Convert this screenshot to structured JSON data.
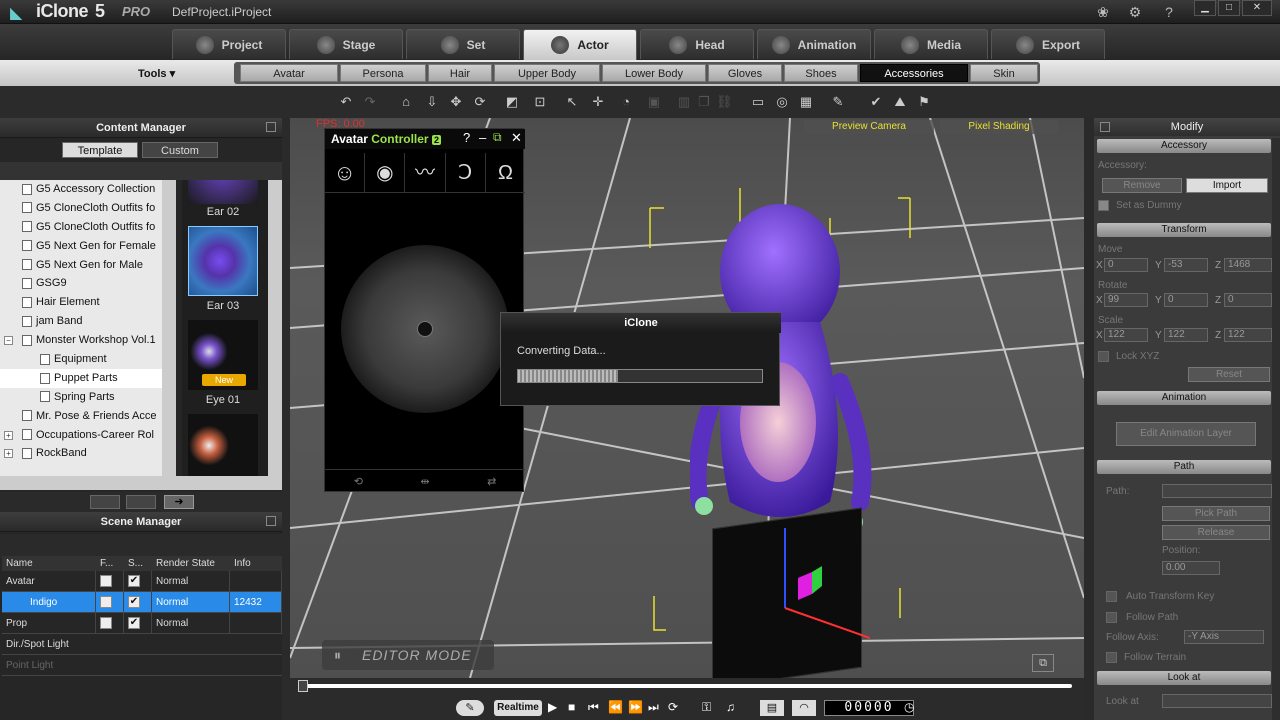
{
  "titlebar": {
    "app": "iClone",
    "version": "5",
    "edition": "PRO",
    "project": "DefProject.iProject"
  },
  "main_tabs": [
    {
      "label": "Project"
    },
    {
      "label": "Stage"
    },
    {
      "label": "Set"
    },
    {
      "label": "Actor",
      "active": true
    },
    {
      "label": "Head"
    },
    {
      "label": "Animation"
    },
    {
      "label": "Media"
    },
    {
      "label": "Export"
    }
  ],
  "tools_label": "Tools ▾",
  "sub_tabs": [
    {
      "label": "Avatar"
    },
    {
      "label": "Persona"
    },
    {
      "label": "Hair"
    },
    {
      "label": "Upper Body"
    },
    {
      "label": "Lower Body"
    },
    {
      "label": "Gloves"
    },
    {
      "label": "Shoes"
    },
    {
      "label": "Accessories",
      "active": true
    },
    {
      "label": "Skin"
    }
  ],
  "content_manager": {
    "title": "Content Manager",
    "tabs": [
      "Template",
      "Custom"
    ],
    "tree": [
      "G5 Accessory Collection",
      "G5 CloneCloth Outfits fo",
      "G5 CloneCloth Outfits fo",
      "G5 Next Gen for Female",
      "G5 Next Gen for Male",
      "GSG9",
      "Hair Element",
      "jam Band",
      "Monster Workshop Vol.1",
      "Equipment",
      "Puppet Parts",
      "Spring Parts",
      "Mr. Pose & Friends Acce",
      "Occupations-Career Rol",
      "RockBand"
    ],
    "thumbnails": [
      {
        "label": "Ear 02"
      },
      {
        "label": "Ear 03"
      },
      {
        "label": "Eye 01",
        "badge": "New"
      },
      {
        "label": ""
      }
    ]
  },
  "scene_manager": {
    "title": "Scene Manager",
    "columns": [
      "Name",
      "F...",
      "S...",
      "Render State",
      "Info"
    ],
    "rows": [
      {
        "name": "Avatar",
        "render": "Normal",
        "info": ""
      },
      {
        "name": "Indigo",
        "render": "Normal",
        "info": "12432",
        "selected": true
      },
      {
        "name": "Prop",
        "render": "Normal",
        "info": ""
      },
      {
        "name": "Dir./Spot Light",
        "render": "",
        "info": ""
      },
      {
        "name": "Point Light",
        "render": "",
        "info": ""
      }
    ]
  },
  "viewport": {
    "fps": "FPS: 0.00",
    "camera": "Preview Camera",
    "shading": "Pixel Shading",
    "editor_mode": "EDITOR MODE"
  },
  "avatar_controller": {
    "title": "Avatar",
    "title_b": "Controller",
    "version": "2"
  },
  "dialog": {
    "title": "iClone",
    "message": "Converting Data...",
    "progress_fraction": 0.41
  },
  "timeline": {
    "realtime": "Realtime",
    "frame": "00000"
  },
  "modify": {
    "title": "Modify",
    "accessory_header": "Accessory",
    "accessory_label": "Accessory:",
    "remove": "Remove",
    "import": "Import",
    "dummy": "Set as Dummy",
    "transform_header": "Transform",
    "move_label": "Move",
    "move": {
      "x": "0",
      "y": "-53",
      "z": "1468"
    },
    "rotate_label": "Rotate",
    "rotate": {
      "x": "99",
      "y": "0",
      "z": "0"
    },
    "scale_label": "Scale",
    "scale": {
      "x": "122",
      "y": "122",
      "z": "122"
    },
    "lock": "Lock XYZ",
    "reset": "Reset",
    "animation_header": "Animation",
    "edit_anim": "Edit Animation Layer",
    "path_header": "Path",
    "path_label": "Path:",
    "pick_path": "Pick Path",
    "release": "Release",
    "position_label": "Position:",
    "position": "0.00",
    "auto_key": "Auto Transform Key",
    "follow_path": "Follow Path",
    "follow_axis_label": "Follow Axis:",
    "follow_axis": "-Y Axis",
    "follow_terrain": "Follow Terrain",
    "look_header": "Look at",
    "look_label": "Look at"
  }
}
